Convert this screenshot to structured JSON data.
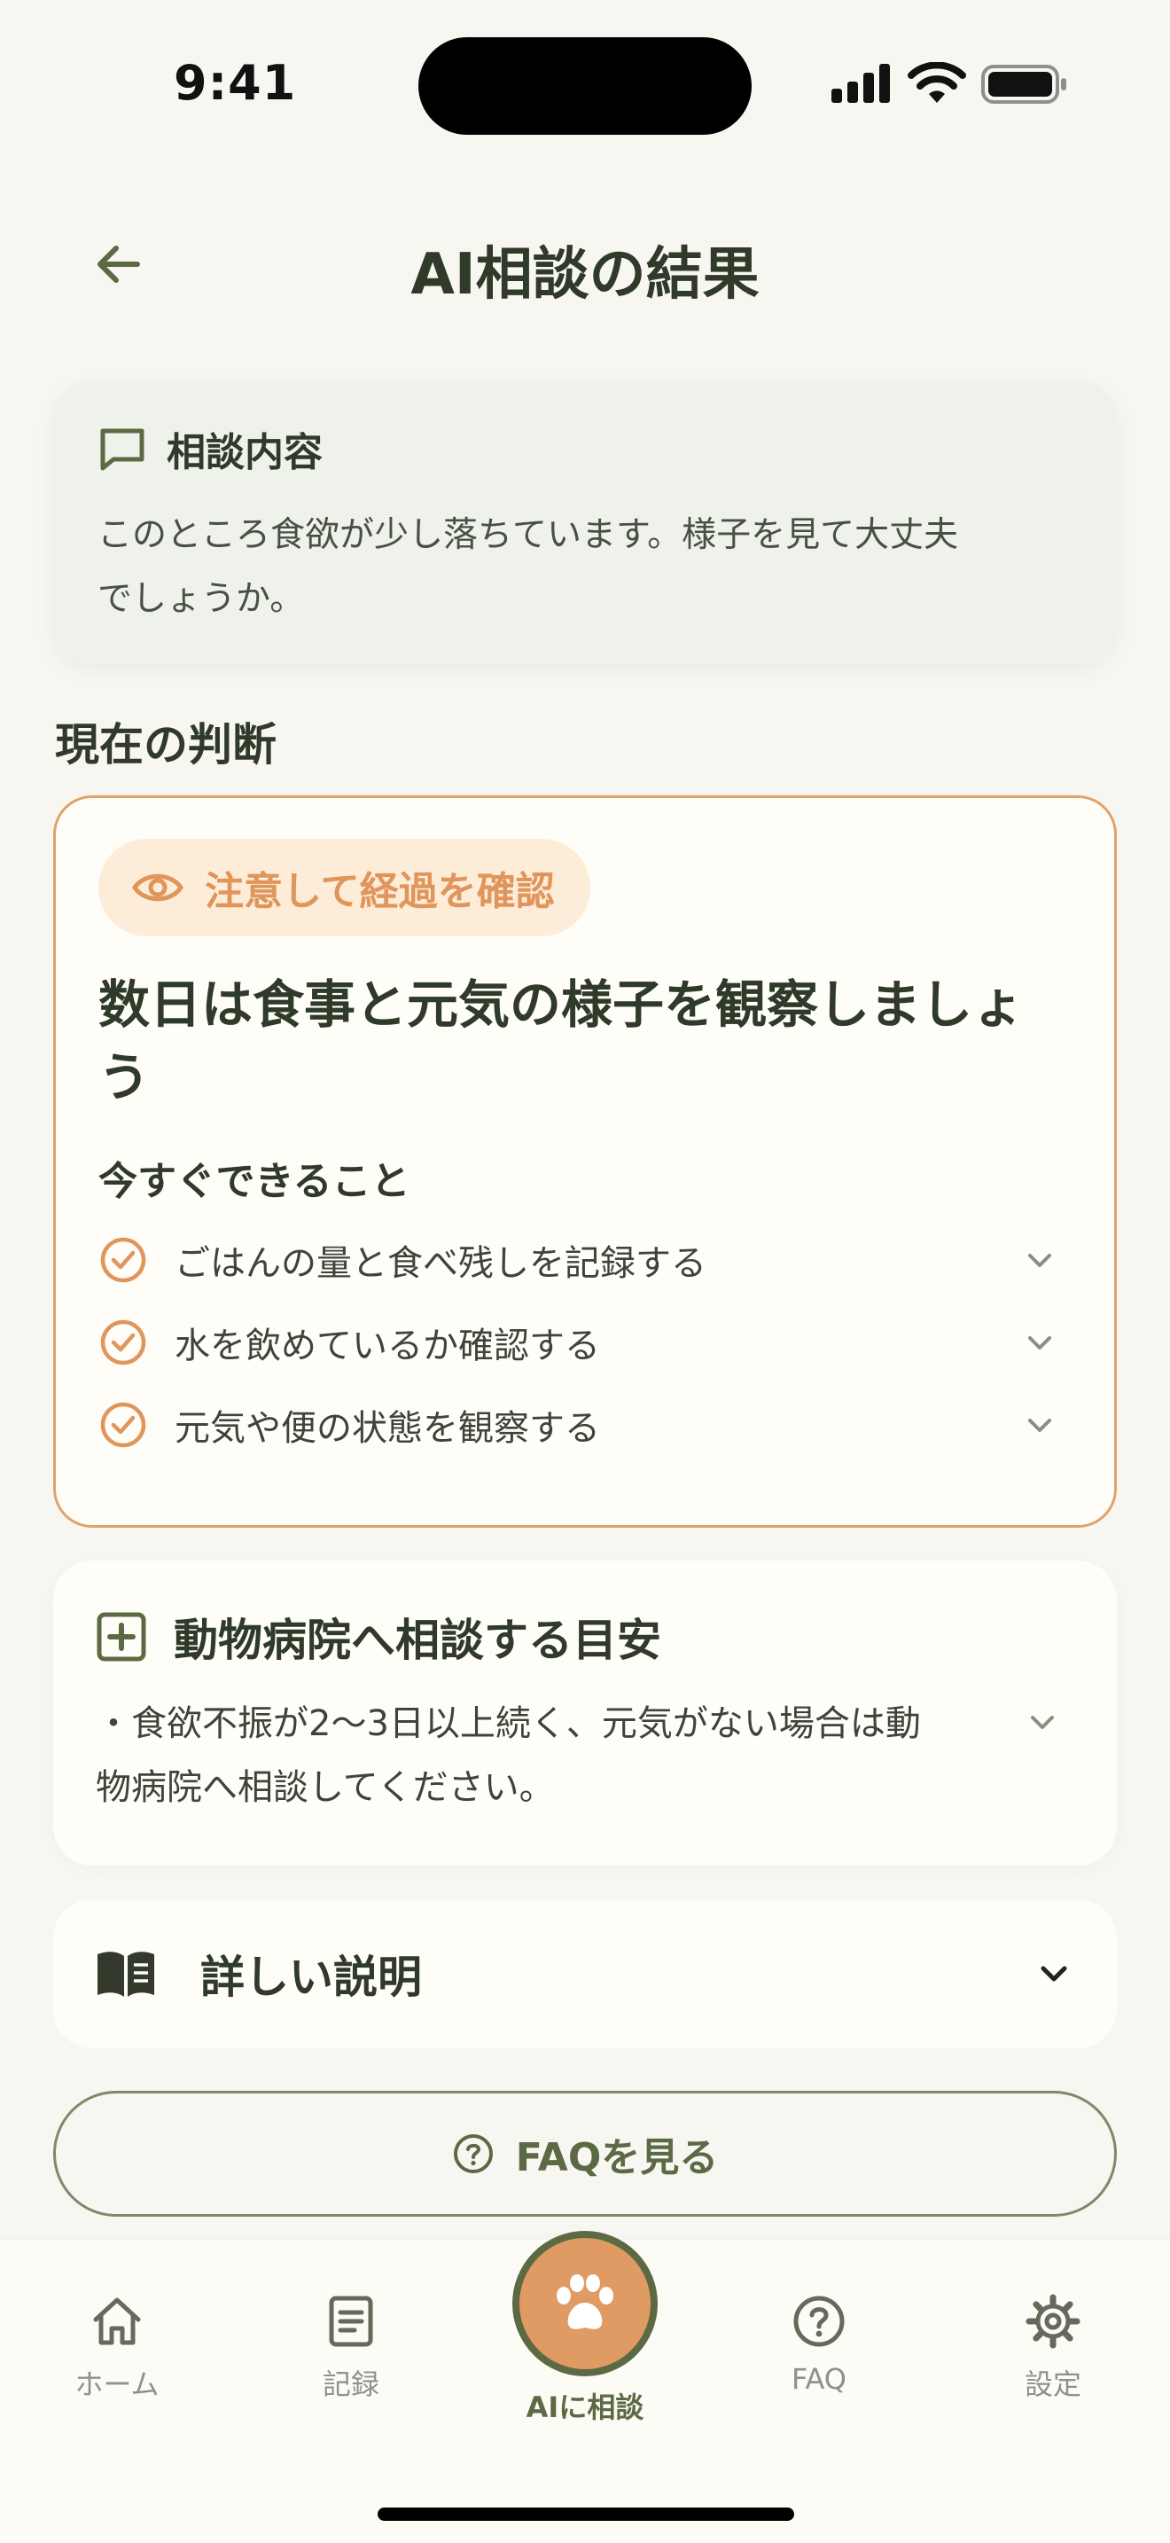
{
  "status_bar": {
    "time": "9:41"
  },
  "header": {
    "title": "AI相談の結果"
  },
  "consult": {
    "title": "相談内容",
    "text_line1": "このところ食欲が少し落ちています。様子を見て大丈夫",
    "text_line2": "でしょうか。"
  },
  "judgment": {
    "section_label": "現在の判断",
    "status": "注意して経過を確認",
    "title_line1": "数日は食事と元気の様子を観察しましょ",
    "title_line2": "う",
    "actions_heading": "今すぐできること",
    "actions": [
      {
        "label": "ごはんの量と食べ残しを記録する"
      },
      {
        "label": "水を飲めているか確認する"
      },
      {
        "label": "元気や便の状態を観察する"
      }
    ]
  },
  "vet": {
    "title": "動物病院へ相談する目安",
    "text_line1": "・食欲不振が2〜3日以上続く、元気がない場合は動",
    "text_line2": "物病院へ相談してください。"
  },
  "detail": {
    "label": "詳しい説明"
  },
  "faq_button": {
    "label": "FAQを見る"
  },
  "tab_bar": {
    "tabs": [
      {
        "label": "ホーム",
        "icon": "home-icon"
      },
      {
        "label": "記録",
        "icon": "notebook-icon"
      },
      {
        "label": "AIに相談",
        "icon": "paw-icon"
      },
      {
        "label": "FAQ",
        "icon": "question-icon"
      },
      {
        "label": "設定",
        "icon": "gear-icon"
      }
    ]
  },
  "colors": {
    "accent_orange": "#e0955a",
    "olive": "#5c6a44",
    "background": "#f8f6f1"
  }
}
